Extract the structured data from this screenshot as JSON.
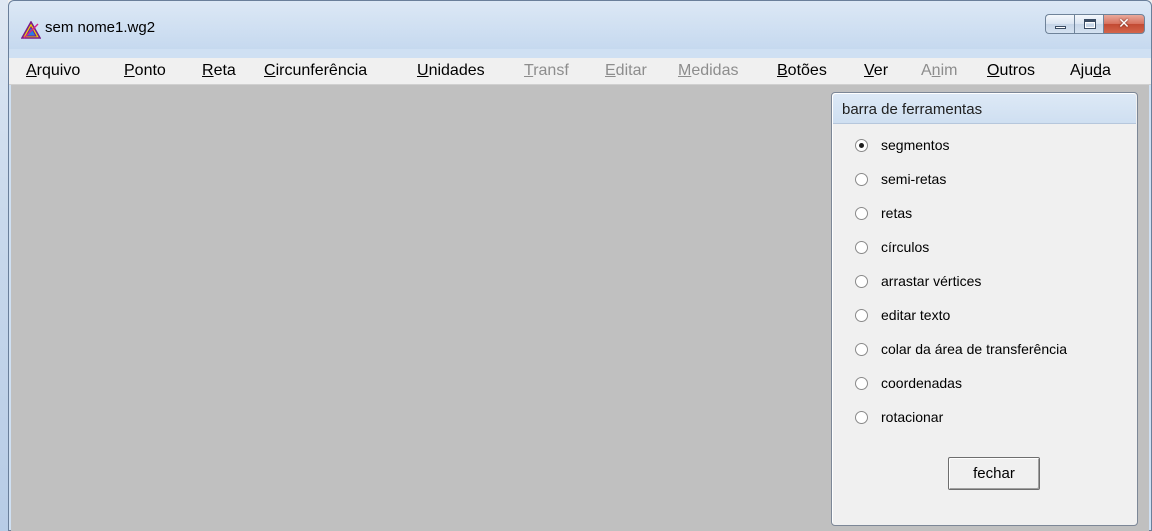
{
  "window": {
    "title": "sem nome1.wg2"
  },
  "menu": {
    "items": [
      {
        "label": "Arquivo",
        "underline_index": 0,
        "enabled": true
      },
      {
        "label": "Ponto",
        "underline_index": 0,
        "enabled": true
      },
      {
        "label": "Reta",
        "underline_index": 0,
        "enabled": true
      },
      {
        "label": "Circunferência",
        "underline_index": 0,
        "enabled": true
      },
      {
        "label": "Unidades",
        "underline_index": 0,
        "enabled": true
      },
      {
        "label": "Transf",
        "underline_index": 0,
        "enabled": false
      },
      {
        "label": "Editar",
        "underline_index": 0,
        "enabled": false
      },
      {
        "label": "Medidas",
        "underline_index": 0,
        "enabled": false
      },
      {
        "label": "Botões",
        "underline_index": 0,
        "enabled": true
      },
      {
        "label": "Ver",
        "underline_index": 0,
        "enabled": true
      },
      {
        "label": "Anim",
        "underline_index": 1,
        "enabled": false
      },
      {
        "label": "Outros",
        "underline_index": 0,
        "enabled": true
      },
      {
        "label": "Ajuda",
        "underline_index": 3,
        "enabled": true
      }
    ]
  },
  "toolbox": {
    "title": "barra de ferramentas",
    "options": [
      {
        "label": "segmentos",
        "checked": true
      },
      {
        "label": "semi-retas",
        "checked": false
      },
      {
        "label": "retas",
        "checked": false
      },
      {
        "label": "círculos",
        "checked": false
      },
      {
        "label": "arrastar vértices",
        "checked": false
      },
      {
        "label": "editar texto",
        "checked": false
      },
      {
        "label": "colar da área de transferência",
        "checked": false
      },
      {
        "label": "coordenadas",
        "checked": false
      },
      {
        "label": "rotacionar",
        "checked": false
      }
    ],
    "close_label": "fechar"
  },
  "colors": {
    "canvas": "#c0c0c0",
    "titlebar": "#cfe0f3",
    "disabled_text": "#8d8d8d"
  },
  "icons": {
    "app": "triangle-app-icon",
    "minimize": "minimize-icon",
    "maximize": "maximize-icon",
    "close": "close-icon"
  }
}
